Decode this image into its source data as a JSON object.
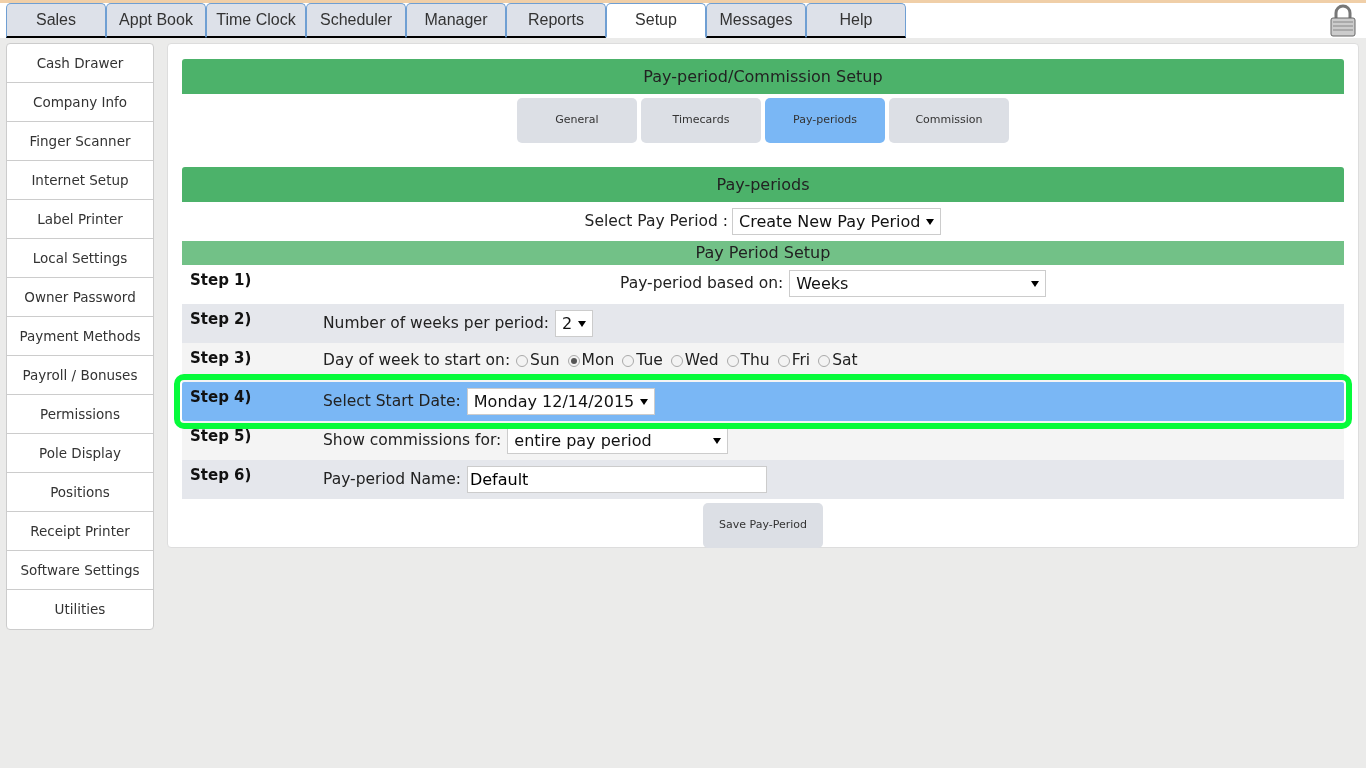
{
  "top_tabs": [
    {
      "label": "Sales",
      "selected": false
    },
    {
      "label": "Appt Book",
      "selected": false
    },
    {
      "label": "Time Clock",
      "selected": false
    },
    {
      "label": "Scheduler",
      "selected": false
    },
    {
      "label": "Manager",
      "selected": false
    },
    {
      "label": "Reports",
      "selected": false
    },
    {
      "label": "Setup",
      "selected": true
    },
    {
      "label": "Messages",
      "selected": false
    },
    {
      "label": "Help",
      "selected": false
    }
  ],
  "sidebar": {
    "items": [
      "Cash Drawer",
      "Company Info",
      "Finger Scanner",
      "Internet Setup",
      "Label Printer",
      "Local Settings",
      "Owner Password",
      "Payment Methods",
      "Payroll / Bonuses",
      "Permissions",
      "Pole Display",
      "Positions",
      "Receipt Printer",
      "Software Settings",
      "Utilities"
    ]
  },
  "header": "Pay-period/Commission Setup",
  "sub_tabs": [
    {
      "label": "General",
      "selected": false
    },
    {
      "label": "Timecards",
      "selected": false
    },
    {
      "label": "Pay-periods",
      "selected": true
    },
    {
      "label": "Commission",
      "selected": false
    }
  ],
  "section_title": "Pay-periods",
  "select_pay_period": {
    "label": "Select Pay Period :",
    "value": "Create New Pay Period"
  },
  "setup_title": "Pay Period Setup",
  "steps": [
    {
      "step": "Step 1)",
      "kind": "select",
      "label": "Pay-period based on:",
      "value": "Weeks",
      "highlighted": false
    },
    {
      "step": "Step 2)",
      "kind": "select",
      "label": "Number of weeks per period:",
      "value": "2",
      "highlighted": false
    },
    {
      "step": "Step 3)",
      "kind": "radio",
      "label": "Day of week to start on:",
      "options": [
        {
          "label": "Sun",
          "selected": false
        },
        {
          "label": "Mon",
          "selected": true
        },
        {
          "label": "Tue",
          "selected": false
        },
        {
          "label": "Wed",
          "selected": false
        },
        {
          "label": "Thu",
          "selected": false
        },
        {
          "label": "Fri",
          "selected": false
        },
        {
          "label": "Sat",
          "selected": false
        }
      ],
      "highlighted": false
    },
    {
      "step": "Step 4)",
      "kind": "select",
      "label": "Select Start Date:",
      "value": "Monday 12/14/2015",
      "highlighted": true
    },
    {
      "step": "Step 5)",
      "kind": "select",
      "label": "Show commissions for:",
      "value": "entire pay period",
      "highlighted": false
    },
    {
      "step": "Step 6)",
      "kind": "text",
      "label": "Pay-period Name:",
      "value": "Default",
      "highlighted": false
    }
  ],
  "save_button": "Save Pay-Period"
}
